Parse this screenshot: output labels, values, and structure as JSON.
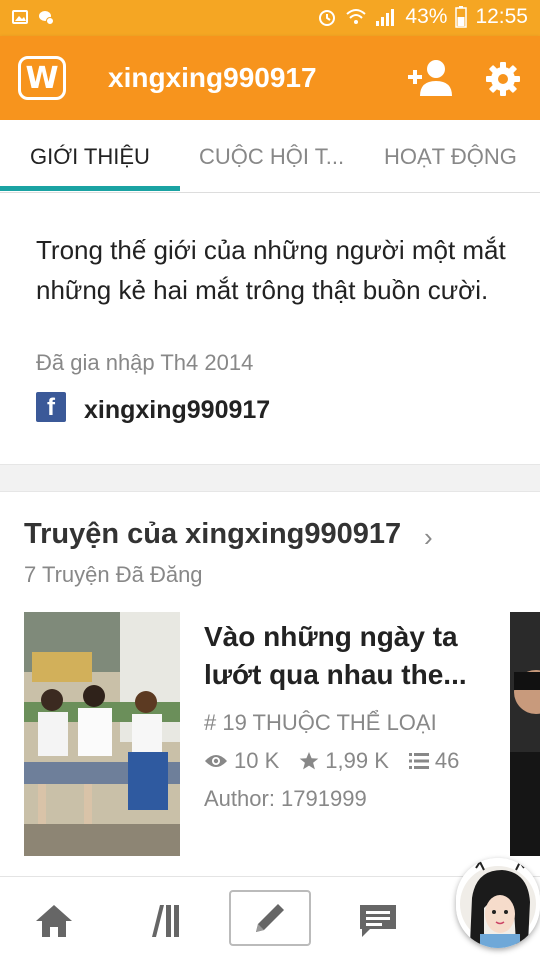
{
  "status_bar": {
    "battery": "43%",
    "time": "12:55",
    "icons": [
      "image-icon",
      "chat-notification-icon",
      "alarm-icon",
      "wifi-icon",
      "signal-icon",
      "battery-icon"
    ]
  },
  "app_bar": {
    "logo_icon": "wattpad-logo-icon",
    "logo_text": "W",
    "username": "xingxing990917",
    "actions": [
      "add-user-icon",
      "gear-icon"
    ]
  },
  "tabs": [
    {
      "label": "GIỚI THIỆU",
      "active": true
    },
    {
      "label": "CUỘC HỘI T...",
      "active": false
    },
    {
      "label": "HOẠT ĐỘNG",
      "active": false
    }
  ],
  "about": {
    "bio": "Trong thế giới của những người một mắt những kẻ hai mắt trông thật buồn cười.",
    "joined": "Đã gia nhập Th4 2014",
    "facebook_letter": "f",
    "facebook_name": "xingxing990917"
  },
  "stories": {
    "title": "Truyện của xingxing990917",
    "chevron": "›",
    "count": "7 Truyện Đã Đăng",
    "items": [
      {
        "title": "Vào những ngày ta lướt qua nhau the...",
        "rank": "# 19 THUỘC THỂ LOẠI",
        "views": "10 K",
        "votes": "1,99 K",
        "parts": "46",
        "author": "Author: 1791999"
      }
    ]
  },
  "bottom_nav": [
    "home-icon",
    "library-icon",
    "write-icon",
    "messages-icon",
    "profile-avatar"
  ],
  "colors": {
    "status_bar": "#f5a623",
    "app_bar": "#f7941d",
    "tab_indicator": "#1aa3a3",
    "facebook": "#3b5998"
  }
}
